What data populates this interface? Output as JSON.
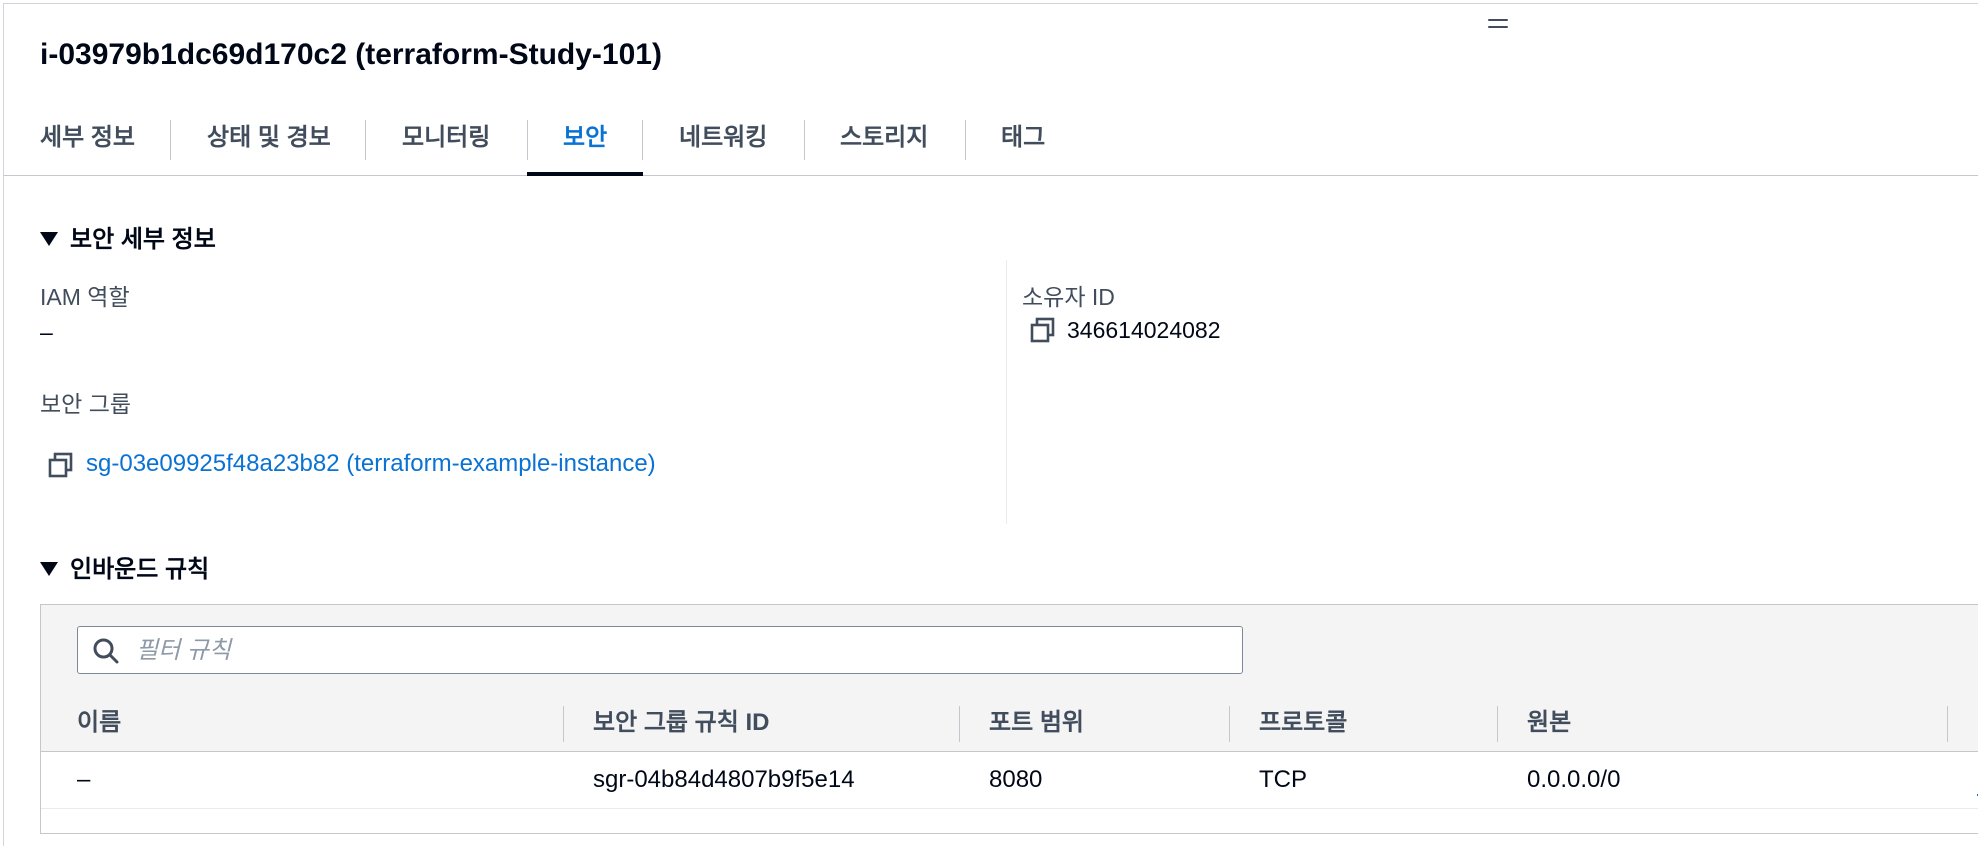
{
  "instance": {
    "title": "i-03979b1dc69d170c2 (terraform-Study-101)"
  },
  "tabs": [
    {
      "label": "세부 정보",
      "active": false
    },
    {
      "label": "상태 및 경보",
      "active": false
    },
    {
      "label": "모니터링",
      "active": false
    },
    {
      "label": "보안",
      "active": true
    },
    {
      "label": "네트워킹",
      "active": false
    },
    {
      "label": "스토리지",
      "active": false
    },
    {
      "label": "태그",
      "active": false
    }
  ],
  "security_details": {
    "heading": "보안 세부 정보",
    "iam_role_label": "IAM 역할",
    "iam_role_value": "–",
    "owner_id_label": "소유자 ID",
    "owner_id_value": "346614024082",
    "security_groups_label": "보안 그룹",
    "security_group_link": "sg-03e09925f48a23b82 (terraform-example-instance)"
  },
  "inbound_rules": {
    "heading": "인바운드 규칙",
    "filter_placeholder": "필터 규칙",
    "columns": [
      "이름",
      "보안 그룹 규칙 ID",
      "포트 범위",
      "프로토콜",
      "원본"
    ],
    "rows": [
      {
        "name": "–",
        "rule_id": "sgr-04b84d4807b9f5e14",
        "port_range": "8080",
        "protocol": "TCP",
        "source": "0.0.0.0/0"
      }
    ]
  },
  "colors": {
    "link": "#0972d3",
    "text": "#000716",
    "secondary_text": "#414d5c",
    "header_bg": "#f4f4f4"
  },
  "icons": [
    "drag-handle-icon",
    "caret-down-icon",
    "copy-icon",
    "search-icon"
  ]
}
